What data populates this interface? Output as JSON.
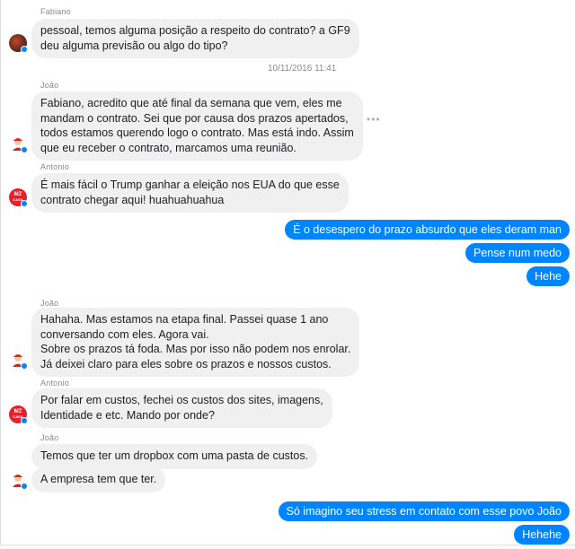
{
  "conversation": {
    "messages": [
      {
        "sender": "Fabiano",
        "lines": [
          "pessoal, temos alguma posição a respeito do contrato? a GF9",
          "deu alguma previsão ou algo do tipo?"
        ]
      },
      {
        "timestamp": "10/11/2016 11:41"
      },
      {
        "sender": "João",
        "lines": [
          "Fabiano, acredito que até final da semana que vem, eles me",
          "mandam o contrato. Sei que por causa dos prazos apertados,",
          "todos estamos querendo logo o contrato. Mas está indo. Assim",
          "que eu receber o contrato, marcamos uma reunião."
        ]
      },
      {
        "sender": "Antonio",
        "lines": [
          "É mais fácil o Trump ganhar a eleição nos EUA do que esse",
          "contrato chegar aqui! huahuahuahua"
        ]
      },
      {
        "outgoing": [
          "É o desespero do prazo absurdo que eles deram man",
          "Pense num medo",
          "Hehe"
        ]
      },
      {
        "sender": "João",
        "lines": [
          "Hahaha. Mas estamos na etapa final. Passei quase 1 ano",
          "conversando com eles. Agora vai.",
          "Sobre os prazos tá foda. Mas por isso não podem nos enrolar.",
          "Já deixei claro para eles sobre os prazos e nossos custos."
        ]
      },
      {
        "sender": "Antonio",
        "lines": [
          "Por falar em custos, fechei os custos dos sites, imagens,",
          "Identidade e etc. Mando por onde?"
        ]
      },
      {
        "sender": "João",
        "lines": [
          "Temos que ter um dropbox com uma pasta de custos."
        ]
      },
      {
        "lines": [
          "A empresa tem que ter."
        ]
      },
      {
        "outgoing": [
          "Só imagino seu stress em contato com esse povo João",
          "Hehehe"
        ]
      }
    ]
  },
  "avatars": {
    "antonio_logo_top": "MZ",
    "antonio_logo_bottom": "CASA"
  },
  "colors": {
    "outgoing_bubble": "#0084ff",
    "incoming_bubble": "#f1f0f0",
    "meta_text": "#8a8a8a"
  },
  "icons": {
    "more_options": "more-options-icon",
    "seen_badge": "messenger-badge-icon"
  }
}
